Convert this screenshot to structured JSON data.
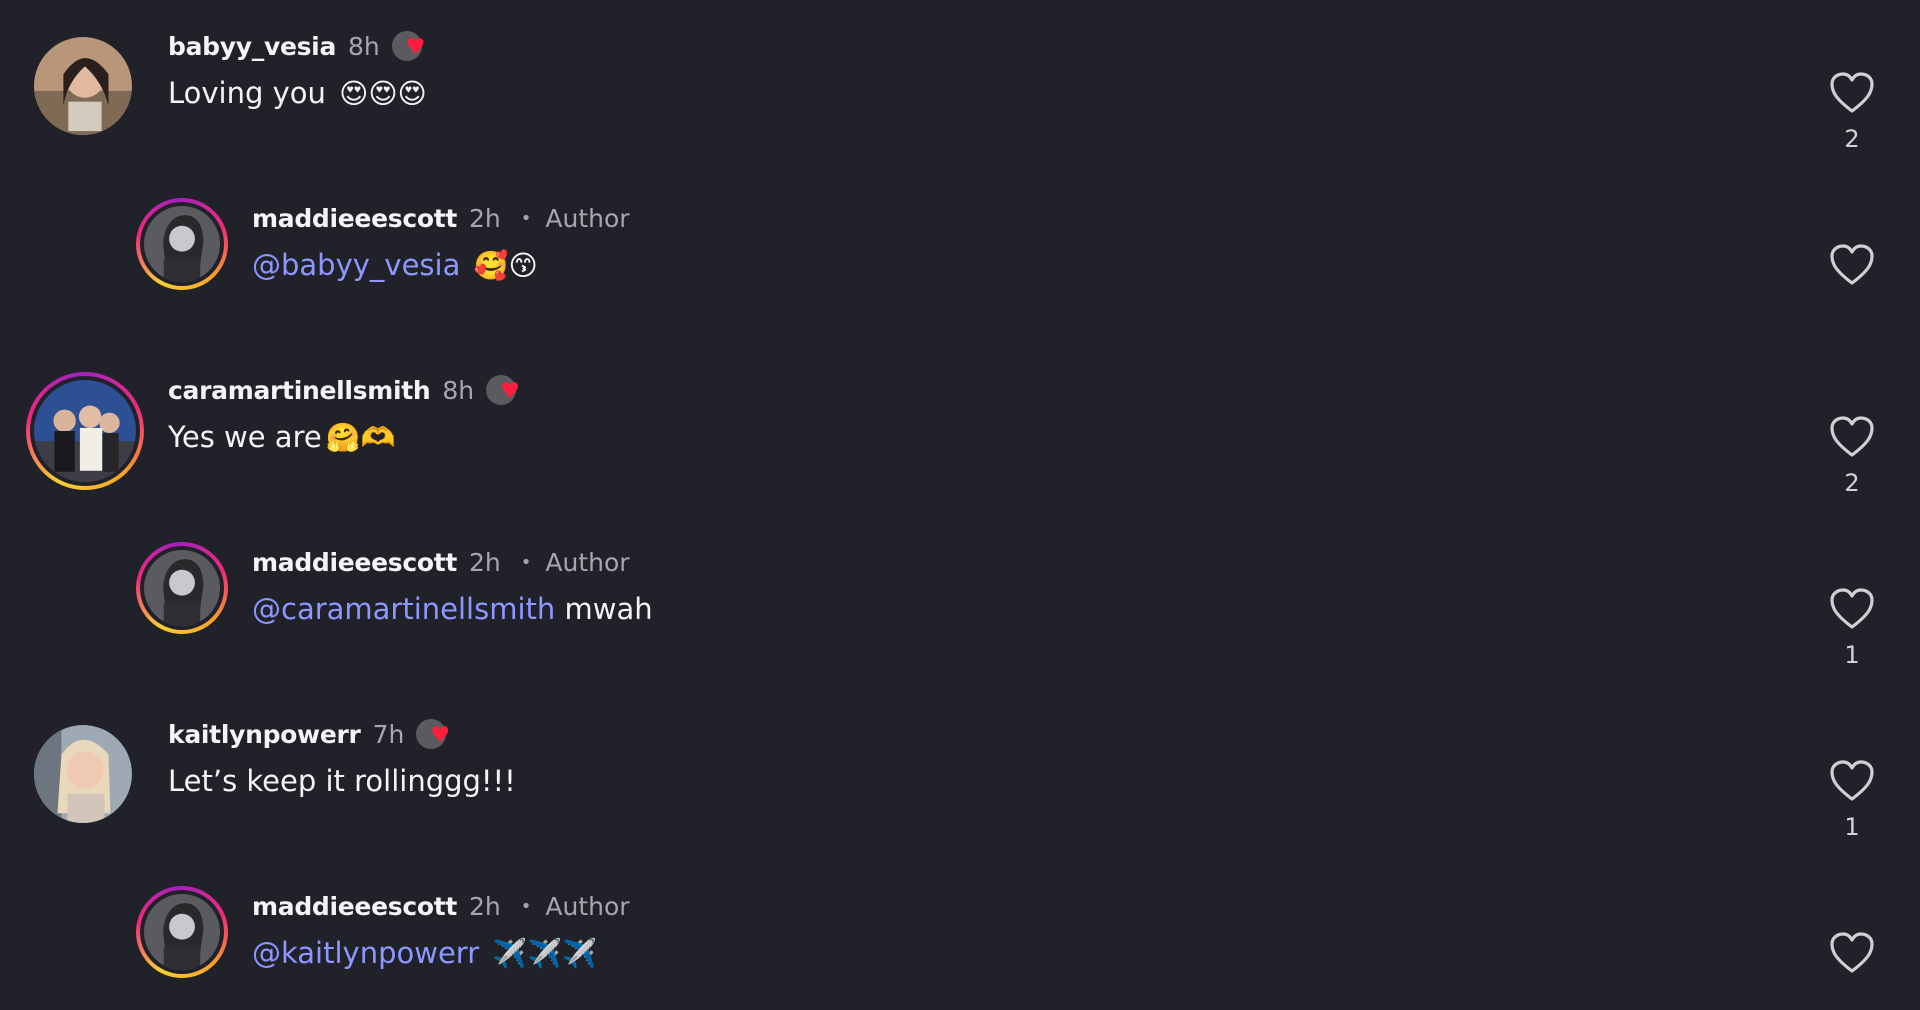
{
  "comments": [
    {
      "username": "babyy_vesia",
      "time": "8h",
      "text": "Loving you",
      "emoji": "😍😍😍",
      "likes": "2",
      "creator_liked": true
    },
    {
      "username": "maddieeescott",
      "time": "2h",
      "author_label": "Author",
      "mention": "@babyy_vesia",
      "emoji": "🥰😙",
      "likes": ""
    },
    {
      "username": "caramartinellsmith",
      "time": "8h",
      "text": "Yes we are",
      "emoji": "🤗🫶",
      "likes": "2",
      "creator_liked": true
    },
    {
      "username": "maddieeescott",
      "time": "2h",
      "author_label": "Author",
      "mention": "@caramartinellsmith",
      "text": "mwah",
      "likes": "1"
    },
    {
      "username": "kaitlynpowerr",
      "time": "7h",
      "text": "Let’s keep it rollinggg!!!",
      "likes": "1",
      "creator_liked": true
    },
    {
      "username": "maddieeescott",
      "time": "2h",
      "author_label": "Author",
      "mention": "@kaitlynpowerr",
      "emoji": "✈️✈️✈️",
      "likes": ""
    }
  ],
  "colors": {
    "background": "#212229",
    "mention": "#8d97ff",
    "secondary_text": "#a6a7ae",
    "heart_badge": "#ff1f3d"
  },
  "icons": {
    "like": "heart-outline-icon",
    "creator_like": "creator-heart-badge-icon",
    "separator": "dot-separator"
  }
}
